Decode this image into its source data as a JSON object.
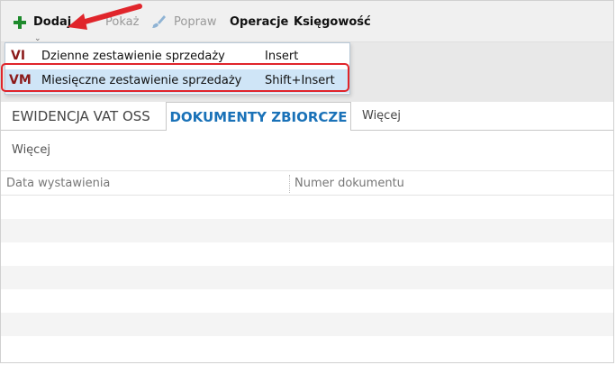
{
  "toolbar": {
    "add_label": "Dodaj",
    "show_label": "Pokaż",
    "edit_label": "Popraw",
    "operations_label": "Operacje",
    "accounting_label": "Księgowość"
  },
  "dropdown": {
    "items": [
      {
        "code": "VI",
        "label": "Dzienne zestawienie sprzedaży",
        "shortcut": "Insert"
      },
      {
        "code": "VM",
        "label": "Miesięczne zestawienie sprzedaży",
        "shortcut": "Shift+Insert"
      }
    ]
  },
  "tabs": [
    {
      "label": "EWIDENCJA VAT OSS"
    },
    {
      "label": "DOKUMENTY ZBIORCZE"
    },
    {
      "label": "Więcej"
    }
  ],
  "filter": {
    "label": "Więcej"
  },
  "grid": {
    "columns": [
      "Data wystawienia",
      "Numer dokumentu"
    ]
  },
  "colors": {
    "accent_red": "#e0252b",
    "tab_active": "#1a72b8",
    "code_red": "#8c1a1a",
    "plus_green": "#1e8a2c",
    "selection": "#cfe5f7"
  }
}
